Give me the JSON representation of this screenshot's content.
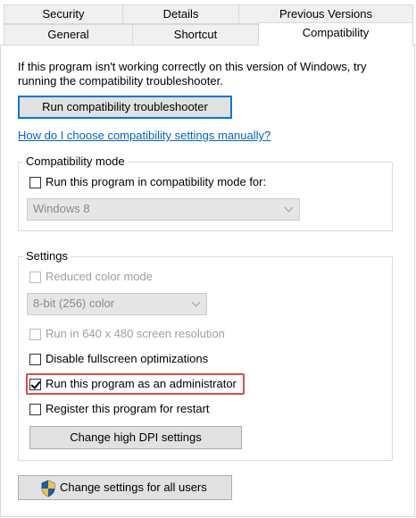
{
  "tabs": {
    "row1": [
      "Security",
      "Details",
      "Previous Versions"
    ],
    "row2": [
      "General",
      "Shortcut",
      "Compatibility"
    ],
    "active": "Compatibility"
  },
  "intro": {
    "line1": "If this program isn't working correctly on this version of Windows, try",
    "line2": "running the compatibility troubleshooter."
  },
  "troubleshooter_button": "Run compatibility troubleshooter",
  "manual_link": "How do I choose compatibility settings manually?",
  "compat_mode": {
    "group_label": "Compatibility mode",
    "checkbox_label": "Run this program in compatibility mode for:",
    "checked": false,
    "dropdown_value": "Windows 8"
  },
  "settings": {
    "group_label": "Settings",
    "reduced_color": {
      "label": "Reduced color mode",
      "checked": false,
      "disabled": true
    },
    "color_dropdown_value": "8-bit (256) color",
    "run_640": {
      "label": "Run in 640 x 480 screen resolution",
      "checked": false,
      "disabled": true
    },
    "disable_fullscreen": {
      "label": "Disable fullscreen optimizations",
      "checked": false
    },
    "run_as_admin": {
      "label": "Run this program as an administrator",
      "checked": true
    },
    "register_restart": {
      "label": "Register this program for restart",
      "checked": false
    },
    "dpi_button": "Change high DPI settings"
  },
  "all_users_button": "Change settings for all users",
  "colors": {
    "highlight": "#e04848",
    "link": "#0066cc",
    "button_focus": "#0078d7"
  },
  "icons": {
    "all_users_button_icon": "uac-shield-icon"
  }
}
